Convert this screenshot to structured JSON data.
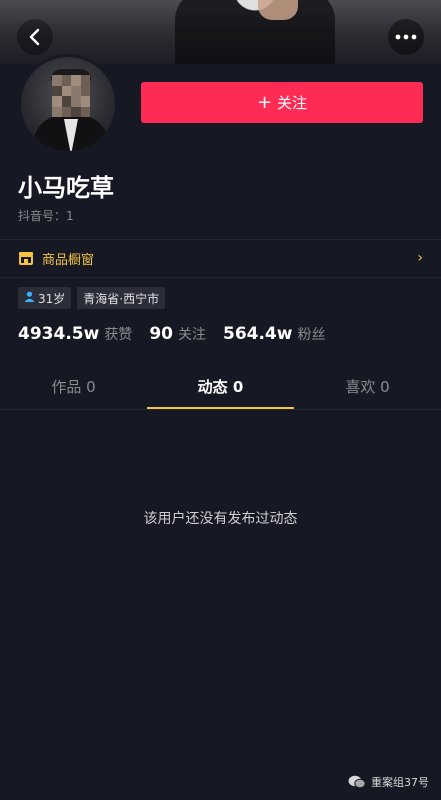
{
  "header": {
    "back_icon": "chevron-left-icon",
    "more_icon": "more-dots-icon"
  },
  "profile": {
    "follow_label": "关注",
    "follow_plus": "+",
    "name": "小马吃草",
    "account_label": "抖音号：",
    "account_value": "1",
    "shop_label": "商品橱窗",
    "tags": [
      {
        "icon": "person-icon",
        "label": "31岁"
      },
      {
        "label": "青海省·西宁市"
      }
    ],
    "stats": [
      {
        "value": "4934.5w",
        "label": "获赞"
      },
      {
        "value": "90",
        "label": "关注"
      },
      {
        "value": "564.4w",
        "label": "粉丝"
      }
    ]
  },
  "tabs": [
    {
      "label": "作品 0"
    },
    {
      "label": "动态 0",
      "active": true
    },
    {
      "label": "喜欢 0"
    }
  ],
  "empty_message": "该用户还没有发布过动态",
  "watermark": "重案组37号",
  "colors": {
    "background": "#161823",
    "follow_button": "#fe2c55",
    "accent": "#f5c443",
    "muted_text": "#8a8b91"
  }
}
